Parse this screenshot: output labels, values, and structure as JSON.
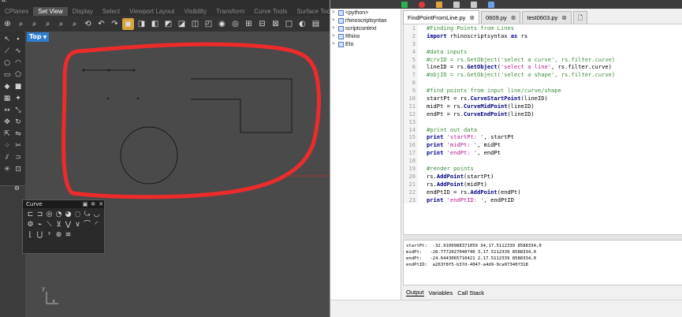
{
  "rhino": {
    "titlebar_fragment": "d:",
    "tabs": [
      "CPlanes",
      "Set View",
      "Display",
      "Select",
      "Viewport Layout",
      "Visibility",
      "Transform",
      "Curve Tools",
      "Surface Tools"
    ],
    "active_tab_index": 1,
    "viewport_label": "Top",
    "axis_y": "y",
    "axis_x": "x",
    "curve_panel_title": "Curve"
  },
  "editor": {
    "tree": [
      {
        "label": "<python>",
        "expandable": true
      },
      {
        "label": "rhinoscriptsyntax",
        "expandable": true
      },
      {
        "label": "scriptcontext",
        "expandable": true
      },
      {
        "label": "Rhino",
        "expandable": true
      },
      {
        "label": "Eto",
        "expandable": true
      }
    ],
    "file_tabs": [
      {
        "label": "FindPointFromLine.py",
        "closable": true,
        "active": true
      },
      {
        "label": "0609.py",
        "closable": true,
        "active": false
      },
      {
        "label": "test0603.py",
        "closable": true,
        "active": false
      }
    ],
    "code_lines": [
      [
        {
          "t": "cm",
          "v": "#Finding Points from Lines"
        }
      ],
      [
        {
          "t": "kw",
          "v": "import"
        },
        {
          "t": "txt",
          "v": " rhinoscriptsyntax "
        },
        {
          "t": "kw",
          "v": "as"
        },
        {
          "t": "txt",
          "v": " rs"
        }
      ],
      [],
      [
        {
          "t": "cm",
          "v": "#data inputs"
        }
      ],
      [
        {
          "t": "cm",
          "v": "#crvID = rs.GetObject('select a curve', rs.filter.curve)"
        }
      ],
      [
        {
          "t": "txt",
          "v": "lineID = rs."
        },
        {
          "t": "fn",
          "v": "GetObject"
        },
        {
          "t": "txt",
          "v": "("
        },
        {
          "t": "st",
          "v": "'select a line'"
        },
        {
          "t": "txt",
          "v": ", rs.filter.curve)"
        }
      ],
      [
        {
          "t": "cm",
          "v": "#objID = rs.GetObject('select a shape', rs.filter.curve)"
        }
      ],
      [],
      [
        {
          "t": "cm",
          "v": "#find points from input line/curve/shape"
        }
      ],
      [
        {
          "t": "txt",
          "v": "startPt = rs."
        },
        {
          "t": "fn",
          "v": "CurveStartPoint"
        },
        {
          "t": "txt",
          "v": "(lineID)"
        }
      ],
      [
        {
          "t": "txt",
          "v": "midPt = rs."
        },
        {
          "t": "fn",
          "v": "CurveMidPoint"
        },
        {
          "t": "txt",
          "v": "(lineID)"
        }
      ],
      [
        {
          "t": "txt",
          "v": "endPt = rs."
        },
        {
          "t": "fn",
          "v": "CurveEndPoint"
        },
        {
          "t": "txt",
          "v": "(lineID)"
        }
      ],
      [],
      [
        {
          "t": "cm",
          "v": "#print out data"
        }
      ],
      [
        {
          "t": "kw",
          "v": "print"
        },
        {
          "t": "txt",
          "v": " "
        },
        {
          "t": "st",
          "v": "'startPt: '"
        },
        {
          "t": "txt",
          "v": ", startPt"
        }
      ],
      [
        {
          "t": "kw",
          "v": "print"
        },
        {
          "t": "txt",
          "v": " "
        },
        {
          "t": "st",
          "v": "'midPt: '"
        },
        {
          "t": "txt",
          "v": ", midPt"
        }
      ],
      [
        {
          "t": "kw",
          "v": "print"
        },
        {
          "t": "txt",
          "v": " "
        },
        {
          "t": "st",
          "v": "'endPt: '"
        },
        {
          "t": "txt",
          "v": ", endPt"
        }
      ],
      [],
      [
        {
          "t": "cm",
          "v": "#render points"
        }
      ],
      [
        {
          "t": "txt",
          "v": "rs."
        },
        {
          "t": "fn",
          "v": "AddPoint"
        },
        {
          "t": "txt",
          "v": "(startPt)"
        }
      ],
      [
        {
          "t": "txt",
          "v": "rs."
        },
        {
          "t": "fn",
          "v": "AddPoint"
        },
        {
          "t": "txt",
          "v": "(midPt)"
        }
      ],
      [
        {
          "t": "txt",
          "v": "endPtID = rs."
        },
        {
          "t": "fn",
          "v": "AddPoint"
        },
        {
          "t": "txt",
          "v": "(endPt)"
        }
      ],
      [
        {
          "t": "kw",
          "v": "print"
        },
        {
          "t": "txt",
          "v": " "
        },
        {
          "t": "st",
          "v": "'endPtID: '"
        },
        {
          "t": "txt",
          "v": ", endPtID"
        }
      ]
    ],
    "output_lines": [
      "startPt:  -32.9100988371059 34,17.5112339 8588334,0",
      "midPt:   -28.7772027040740 3,17.5112339 8588334,0",
      "endPt:   -24.6443065710421 2,17.5112339 8588334,0",
      "endPtID:  a263f8f5-b37d-4047-a4d9-9ca07340f318"
    ],
    "output_tabs": [
      "Output",
      "Variables",
      "Call Stack"
    ],
    "active_output_tab": 0
  }
}
